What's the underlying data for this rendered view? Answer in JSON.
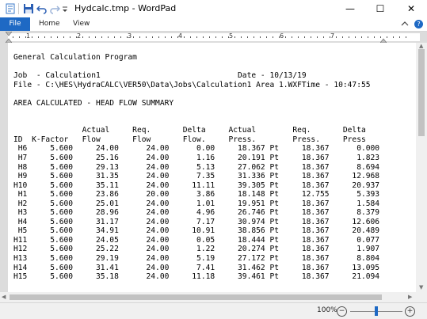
{
  "window": {
    "title": "Hydcalc.tmp - WordPad",
    "minimize": "—",
    "maximize": "☐",
    "close": "✕"
  },
  "ribbon": {
    "tabs": [
      "File",
      "Home",
      "View"
    ]
  },
  "ruler": {
    "numbers": [
      "1",
      "2",
      "3",
      "4",
      "5",
      "6",
      "7"
    ]
  },
  "document": {
    "lines": [
      "General Calculation Program",
      "",
      "Job  - Calculation1                              Date - 10/13/19",
      "File - C:\\HES\\HydraCALC\\VER50\\Data\\Jobs\\Calculation1 Area 1.WXFTime - 10:47:55",
      "",
      "AREA CALCULATED - HEAD FLOW SUMMARY",
      "",
      "",
      "               Actual     Req.       Delta     Actual        Req.       Delta",
      "ID  K-Factor   Flow       Flow       Flow.     Press.        Press.     Press",
      " H6     5.600     24.00      24.00      0.00     18.367 Pt     18.367      0.000",
      " H7     5.600     25.16      24.00      1.16     20.191 Pt     18.367      1.823",
      " H8     5.600     29.13      24.00      5.13     27.062 Pt     18.367      8.694",
      " H9     5.600     31.35      24.00      7.35     31.336 Pt     18.367     12.968",
      "H10     5.600     35.11      24.00     11.11     39.305 Pt     18.367     20.937",
      " H1     5.600     23.86      20.00      3.86     18.148 Pt     12.755      5.393",
      " H2     5.600     25.01      24.00      1.01     19.951 Pt     18.367      1.584",
      " H3     5.600     28.96      24.00      4.96     26.746 Pt     18.367      8.379",
      " H4     5.600     31.17      24.00      7.17     30.974 Pt     18.367     12.606",
      " H5     5.600     34.91      24.00     10.91     38.856 Pt     18.367     20.489",
      "H11     5.600     24.05      24.00      0.05     18.444 Pt     18.367      0.077",
      "H12     5.600     25.22      24.00      1.22     20.274 Pt     18.367      1.907",
      "H13     5.600     29.19      24.00      5.19     27.172 Pt     18.367      8.804",
      "H14     5.600     31.41      24.00      7.41     31.462 Pt     18.367     13.095",
      "H15     5.600     35.18      24.00     11.18     39.461 Pt     18.367     21.094"
    ]
  },
  "statusbar": {
    "zoom": "100%",
    "zoom_out": "−",
    "zoom_in": "+",
    "zoom_level": 0.5
  },
  "colors": {
    "accent": "#1e69c4"
  }
}
